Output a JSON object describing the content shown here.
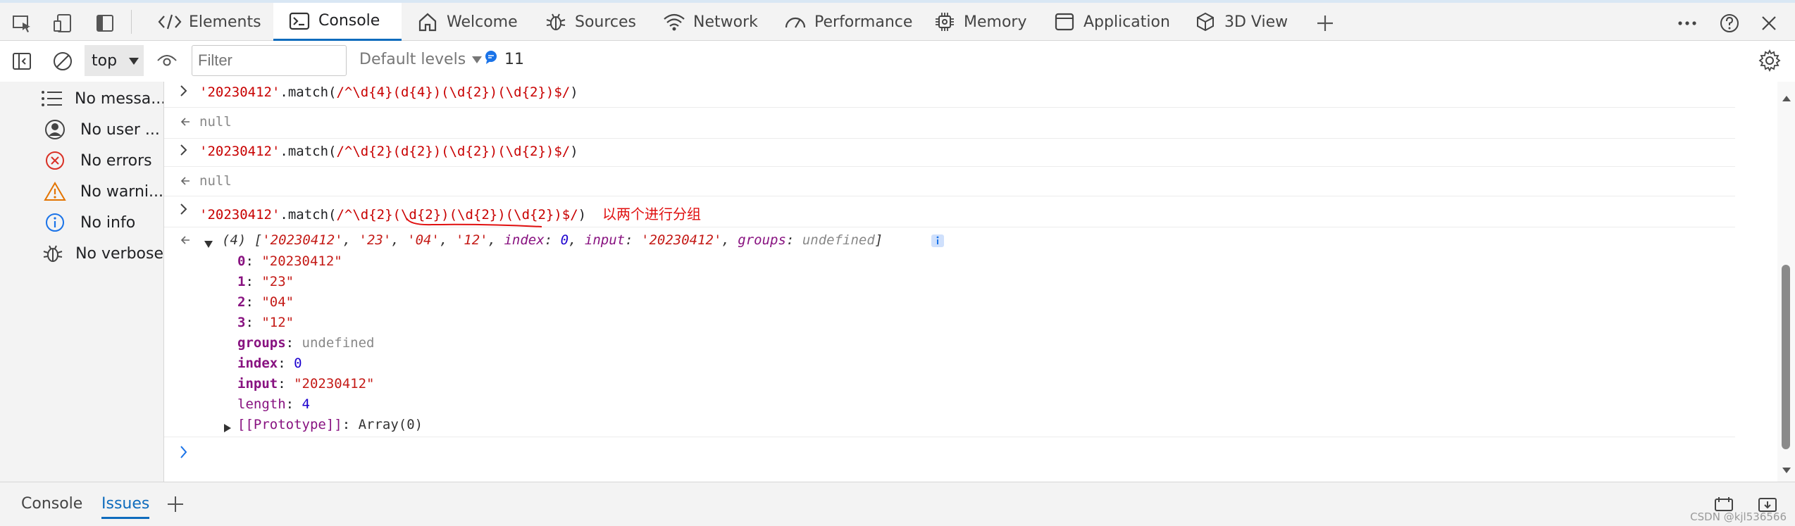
{
  "tabs": [
    {
      "label": "Elements",
      "icon": "code-icon"
    },
    {
      "label": "Console",
      "icon": "console-icon",
      "active": true
    },
    {
      "label": "Welcome",
      "icon": "home-icon"
    },
    {
      "label": "Sources",
      "icon": "bug-icon"
    },
    {
      "label": "Network",
      "icon": "wifi-icon"
    },
    {
      "label": "Performance",
      "icon": "gauge-icon"
    },
    {
      "label": "Memory",
      "icon": "chip-icon"
    },
    {
      "label": "Application",
      "icon": "window-icon"
    },
    {
      "label": "3D View",
      "icon": "cube-icon"
    }
  ],
  "toolbar": {
    "context": "top",
    "filter_placeholder": "Filter",
    "levels": "Default levels",
    "issue_count": "11"
  },
  "sidebar": {
    "items": [
      {
        "label": "No messa...",
        "icon": "list-icon"
      },
      {
        "label": "No user ...",
        "icon": "user-icon"
      },
      {
        "label": "No errors",
        "icon": "error-icon"
      },
      {
        "label": "No warni...",
        "icon": "warning-icon"
      },
      {
        "label": "No info",
        "icon": "info-icon"
      },
      {
        "label": "No verbose",
        "icon": "bug-icon"
      }
    ]
  },
  "console": {
    "in1_str": "'20230412'",
    "in1_fn": ".match(",
    "in1_rx": "/^\\d{4}(d{4})(\\d{2})(\\d{2})$/",
    "in1_end": ")",
    "out1": "null",
    "in2_str": "'20230412'",
    "in2_fn": ".match(",
    "in2_rx": "/^\\d{2}(d{2})(\\d{2})(\\d{2})$/",
    "in2_end": ")",
    "out2": "null",
    "in3_str": "'20230412'",
    "in3_fn": ".match(",
    "in3_rx": "/^\\d{2}(\\d{2})(\\d{2})(\\d{2})$/",
    "in3_end": ")",
    "in3_note": "以两个进行分组",
    "result_summary": {
      "count": "(4)",
      "open": "[",
      "v0": "'20230412'",
      "v1": "'23'",
      "v2": "'04'",
      "v3": "'12'",
      "k_index": "index",
      "v_index": "0",
      "k_input": "input",
      "v_input": "'20230412'",
      "k_groups": "groups",
      "v_groups": "undefined",
      "close": "]"
    },
    "props": [
      {
        "key": "0",
        "value": "\"20230412\"",
        "type": "str"
      },
      {
        "key": "1",
        "value": "\"23\"",
        "type": "str"
      },
      {
        "key": "2",
        "value": "\"04\"",
        "type": "str"
      },
      {
        "key": "3",
        "value": "\"12\"",
        "type": "str"
      },
      {
        "key": "groups",
        "value": "undefined",
        "type": "undef"
      },
      {
        "key": "index",
        "value": "0",
        "type": "num"
      },
      {
        "key": "input",
        "value": "\"20230412\"",
        "type": "str"
      },
      {
        "key": "length",
        "value": "4",
        "type": "num"
      }
    ],
    "prototype_key": "[[Prototype]]",
    "prototype_value": "Array(0)"
  },
  "bottom_tabs": {
    "console": "Console",
    "issues": "Issues"
  },
  "watermark": "CSDN @kjl536566"
}
